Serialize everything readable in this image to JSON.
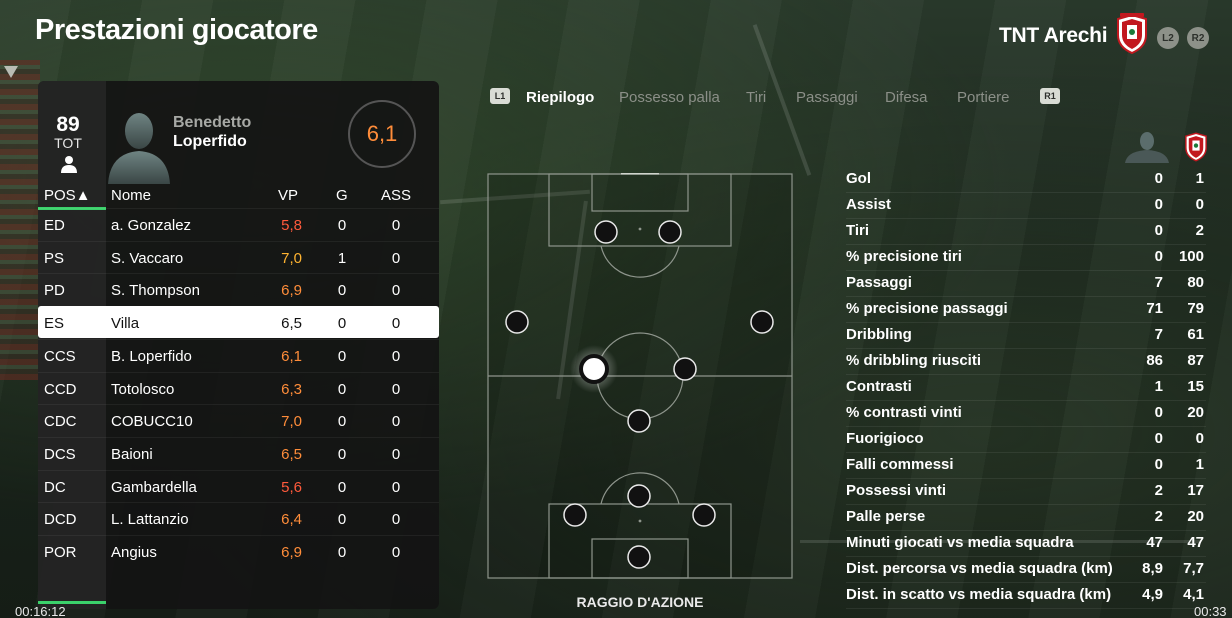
{
  "header": {
    "title": "Prestazioni giocatore",
    "team_name": "TNT Arechi",
    "button_l2": "L2",
    "button_r2": "R2"
  },
  "player_card": {
    "overall": "89",
    "overall_label": "TOT",
    "first_name": "Benedetto",
    "last_name": "Loperfido",
    "rating": "6,1"
  },
  "players_table": {
    "columns": {
      "pos": "POS▲",
      "name": "Nome",
      "vp": "VP",
      "g": "G",
      "ass": "ASS"
    },
    "rows": [
      {
        "pos": "ED",
        "name": "a. Gonzalez",
        "vp": "5,8",
        "vp_color": "#ff5a3c",
        "g": "0",
        "ass": "0"
      },
      {
        "pos": "PS",
        "name": "S. Vaccaro",
        "vp": "7,0",
        "vp_color": "#ffb431",
        "g": "1",
        "ass": "0"
      },
      {
        "pos": "PD",
        "name": "S. Thompson",
        "vp": "6,9",
        "vp_color": "#ff8d3a",
        "g": "0",
        "ass": "0"
      },
      {
        "pos": "ES",
        "name": "Villa",
        "vp": "6,5",
        "vp_color": "#111111",
        "g": "0",
        "ass": "0",
        "selected": true
      },
      {
        "pos": "CCS",
        "name": "B. Loperfido",
        "vp": "6,1",
        "vp_color": "#ff8d3a",
        "g": "0",
        "ass": "0"
      },
      {
        "pos": "CCD",
        "name": "Totolosco",
        "vp": "6,3",
        "vp_color": "#ff8d3a",
        "g": "0",
        "ass": "0"
      },
      {
        "pos": "CDC",
        "name": "COBUCC10",
        "vp": "7,0",
        "vp_color": "#ff8d3a",
        "g": "0",
        "ass": "0"
      },
      {
        "pos": "DCS",
        "name": "Baioni",
        "vp": "6,5",
        "vp_color": "#ff8d3a",
        "g": "0",
        "ass": "0"
      },
      {
        "pos": "DC",
        "name": "Gambardella",
        "vp": "5,6",
        "vp_color": "#ff5a3c",
        "g": "0",
        "ass": "0"
      },
      {
        "pos": "DCD",
        "name": "L. Lattanzio",
        "vp": "6,4",
        "vp_color": "#ff8d3a",
        "g": "0",
        "ass": "0"
      },
      {
        "pos": "POR",
        "name": "Angius",
        "vp": "6,9",
        "vp_color": "#ff8d3a",
        "g": "0",
        "ass": "0"
      }
    ]
  },
  "tabs": {
    "key_left": "L1",
    "key_right": "R1",
    "items": [
      {
        "label": "Riepilogo",
        "active": true
      },
      {
        "label": "Possesso palla",
        "active": false
      },
      {
        "label": "Tiri",
        "active": false
      },
      {
        "label": "Passaggi",
        "active": false
      },
      {
        "label": "Difesa",
        "active": false
      },
      {
        "label": "Portiere",
        "active": false
      }
    ]
  },
  "pitch": {
    "caption": "RAGGIO D'AZIONE"
  },
  "stats": {
    "rows": [
      {
        "label": "Gol",
        "player": "0",
        "team": "1"
      },
      {
        "label": "Assist",
        "player": "0",
        "team": "0"
      },
      {
        "label": "Tiri",
        "player": "0",
        "team": "2"
      },
      {
        "label": "% precisione tiri",
        "player": "0",
        "team": "100"
      },
      {
        "label": "Passaggi",
        "player": "7",
        "team": "80"
      },
      {
        "label": "% precisione passaggi",
        "player": "71",
        "team": "79"
      },
      {
        "label": "Dribbling",
        "player": "7",
        "team": "61"
      },
      {
        "label": "% dribbling riusciti",
        "player": "86",
        "team": "87"
      },
      {
        "label": "Contrasti",
        "player": "1",
        "team": "15"
      },
      {
        "label": "% contrasti vinti",
        "player": "0",
        "team": "20"
      },
      {
        "label": "Fuorigioco",
        "player": "0",
        "team": "0"
      },
      {
        "label": "Falli commessi",
        "player": "0",
        "team": "1"
      },
      {
        "label": "Possessi vinti",
        "player": "2",
        "team": "17"
      },
      {
        "label": "Palle perse",
        "player": "2",
        "team": "20"
      },
      {
        "label": "Minuti giocati vs media squadra",
        "player": "47",
        "team": "47"
      },
      {
        "label": "Dist. percorsa vs media squadra (km)",
        "player": "8,9",
        "team": "7,7"
      },
      {
        "label": "Dist. in scatto vs media squadra (km)",
        "player": "4,9",
        "team": "4,1"
      }
    ]
  },
  "timers": {
    "left": "00:16:12",
    "right": "00:33"
  },
  "colors": {
    "accent_green": "#3bd16b",
    "rating_orange": "#ff8d3a",
    "rating_red": "#ff5a3c",
    "rating_yellow": "#ffb431"
  }
}
